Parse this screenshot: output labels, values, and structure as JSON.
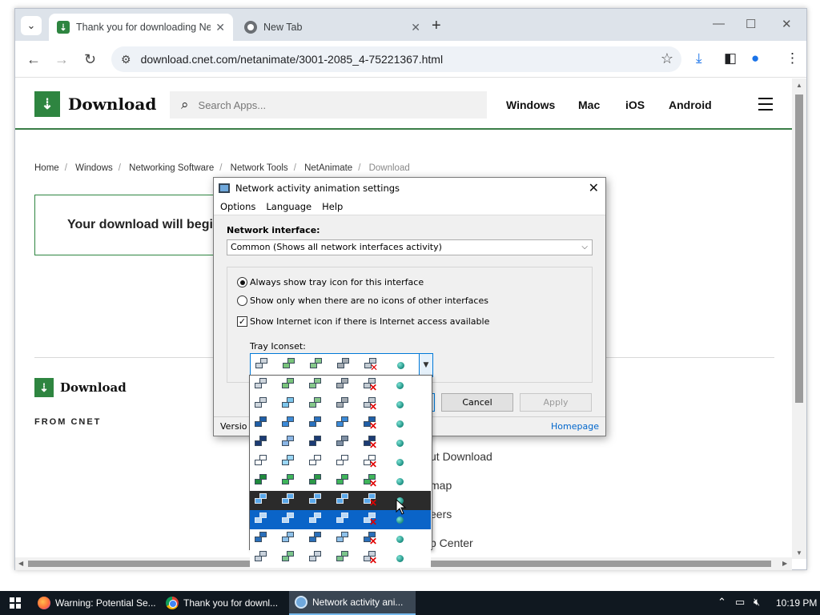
{
  "browser": {
    "tabs": [
      {
        "title": "Thank you for downloading Ne",
        "active": true
      },
      {
        "title": "New Tab",
        "active": false
      }
    ],
    "url": "download.cnet.com/netanimate/3001-2085_4-75221367.html"
  },
  "site": {
    "logo": "Download",
    "search_placeholder": "Search Apps...",
    "nav": [
      "Windows",
      "Mac",
      "iOS",
      "Android"
    ],
    "breadcrumb": [
      "Home",
      "Windows",
      "Networking Software",
      "Network Tools",
      "NetAnimate",
      "Download"
    ],
    "download_message": "Your download will begin",
    "footer": {
      "logo": "Download",
      "from": "FROM CNET",
      "links": [
        "ut Download",
        "map",
        "eers",
        "p Center"
      ]
    }
  },
  "dialog": {
    "title": "Network activity animation settings",
    "menu": [
      "Options",
      "Language",
      "Help"
    ],
    "network_interface_label": "Network interface:",
    "network_interface_value": "Common (Shows all network interfaces activity)",
    "options": {
      "always_show": "Always show tray icon for this interface",
      "show_only": "Show only when there are no icons of other interfaces",
      "show_internet": "Show Internet icon if there is Internet access available"
    },
    "tray_iconset_label": "Tray Iconset:",
    "buttons": {
      "cancel": "Cancel",
      "apply": "Apply"
    },
    "version": "Versio",
    "homepage": "Homepage"
  },
  "iconsets": {
    "selected_row": 0,
    "rows": [
      {
        "bg": "#ffffff",
        "c": [
          "#cfd6dd",
          "#79c47a",
          "#86c88a",
          "#a3aab1",
          "#c4ccd3"
        ]
      },
      {
        "bg": "#ffffff",
        "c": [
          "#cfd6dd",
          "#7dc6ec",
          "#86c88a",
          "#a3aab1",
          "#c4ccd3"
        ]
      },
      {
        "bg": "#ffffff",
        "c": [
          "#1f5fa8",
          "#3b8ad8",
          "#2a72c0",
          "#3b8ad8",
          "#1f5fa8"
        ]
      },
      {
        "bg": "#ffffff",
        "c": [
          "#1c3b74",
          "#8bb6e6",
          "#1c3b74",
          "#7f8fa3",
          "#1c3b74"
        ]
      },
      {
        "bg": "#ffffff",
        "c": [
          "#ffffff",
          "#9bd7f5",
          "#ffffff",
          "#ffffff",
          "#ffffff"
        ]
      },
      {
        "bg": "#ffffff",
        "c": [
          "#1f8a3c",
          "#3fb55a",
          "#2d9a48",
          "#3fb55a",
          "#3fb55a"
        ]
      },
      {
        "bg": "#2b2b2b",
        "c": [
          "#5aa8ea",
          "#5aa8ea",
          "#5aa8ea",
          "#5aa8ea",
          "#5aa8ea"
        ]
      },
      {
        "bg": "#0a64c8",
        "c": [
          "#b9d8f6",
          "#b9d8f6",
          "#b9d8f6",
          "#b9d8f6",
          "#b9d8f6"
        ]
      },
      {
        "bg": "#ffffff",
        "c": [
          "#2a6fba",
          "#8ec1ea",
          "#2a6fba",
          "#8ec1ea",
          "#2a6fba"
        ]
      },
      {
        "bg": "#ffffff",
        "c": [
          "#c9d2dc",
          "#7cc58b",
          "#c9d2dc",
          "#7cc58b",
          "#c9d2dc"
        ]
      }
    ]
  },
  "taskbar": {
    "items": [
      "Warning: Potential Se...",
      "Thank you for downl...",
      "Network activity ani..."
    ],
    "time": "10:19 PM"
  }
}
